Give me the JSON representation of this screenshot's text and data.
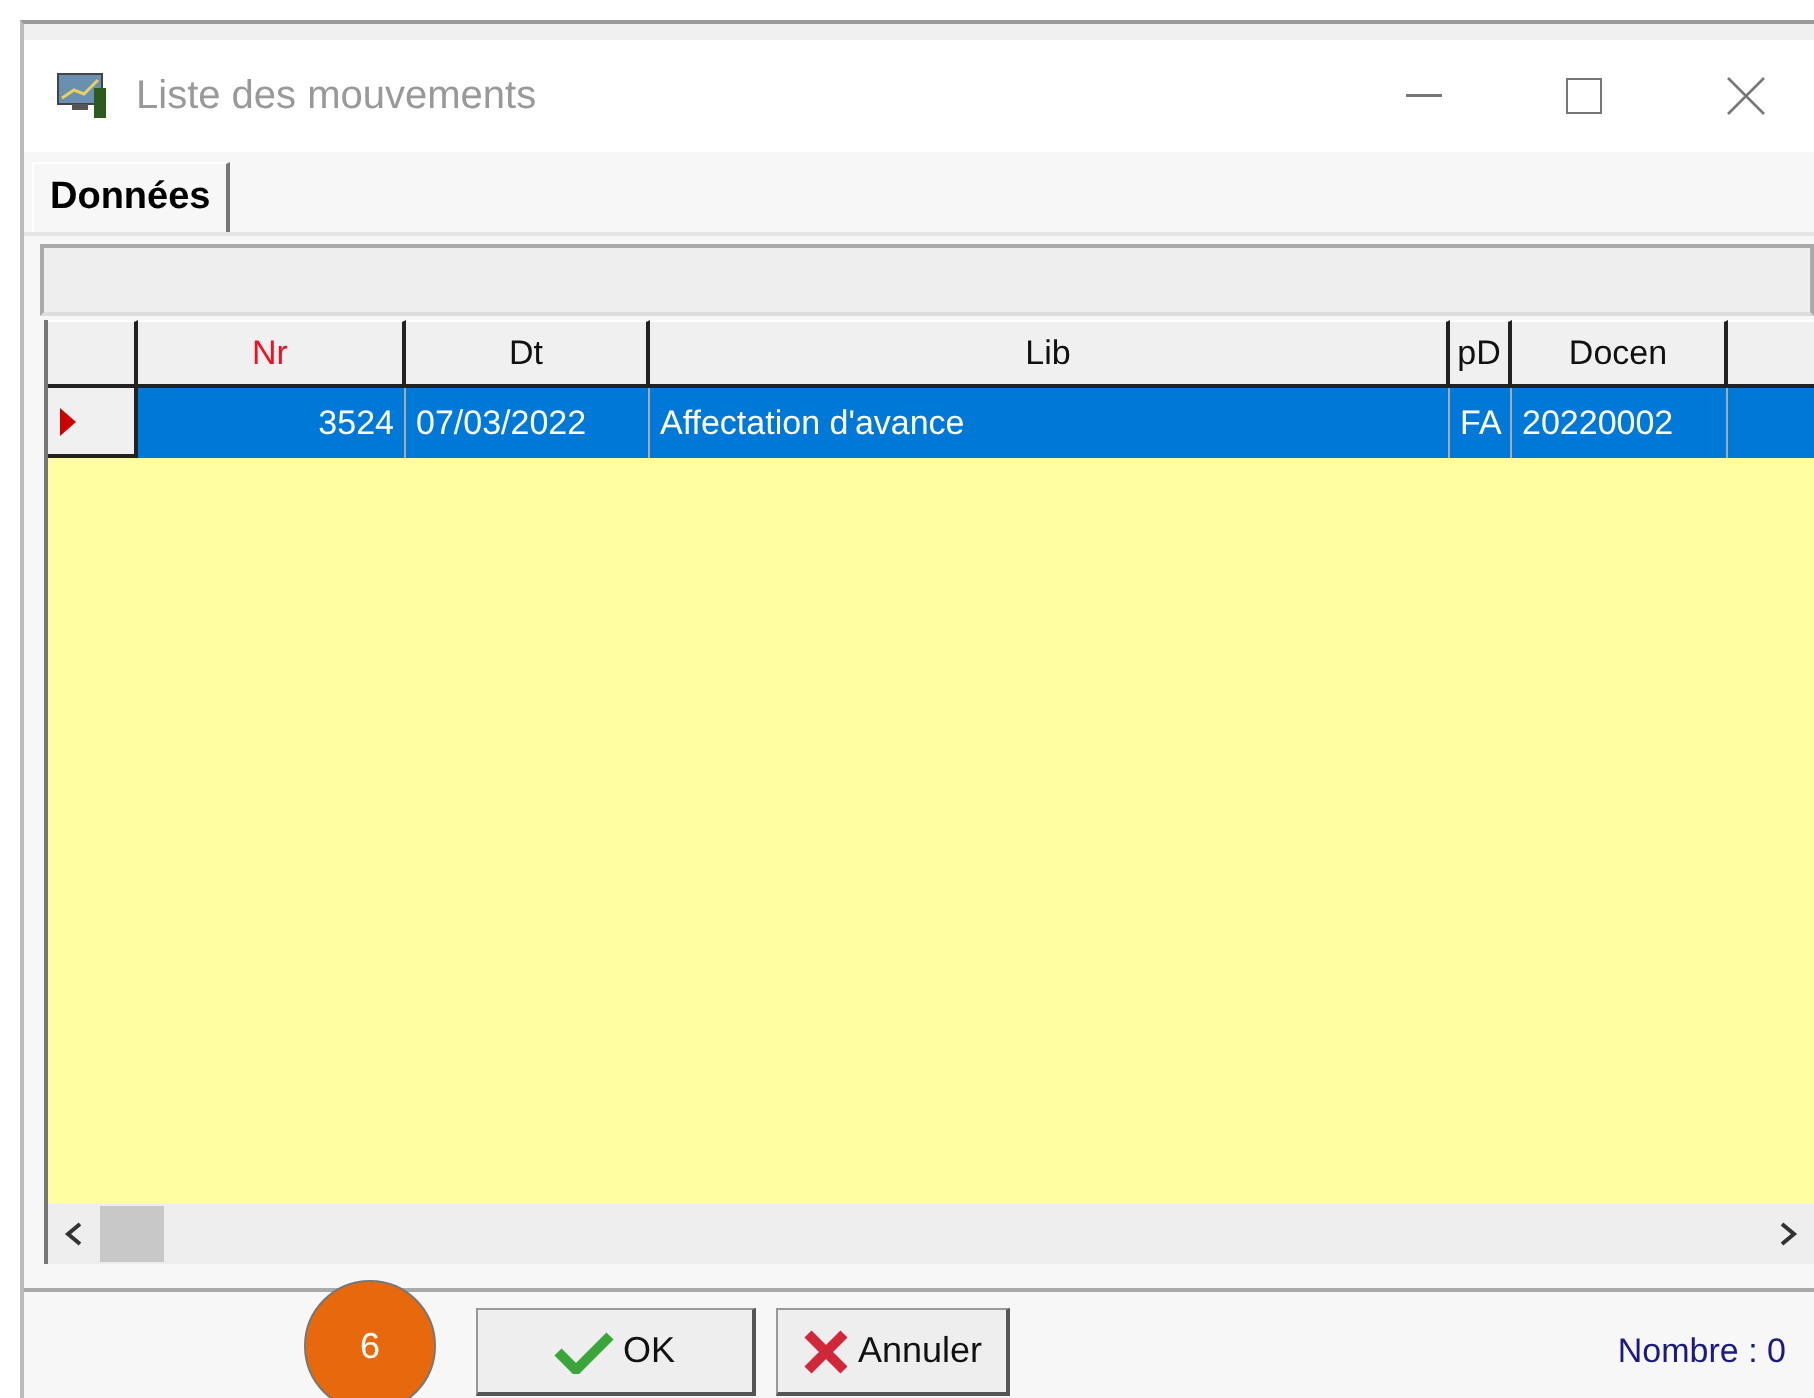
{
  "window": {
    "title": "Liste des mouvements"
  },
  "tabs": [
    {
      "label": "Données",
      "selected": true
    }
  ],
  "table": {
    "columns": [
      {
        "label": "Nr",
        "key_field": true
      },
      {
        "label": "Dt",
        "key_field": false
      },
      {
        "label": "Lib",
        "key_field": false
      },
      {
        "label": "pD",
        "key_field": false
      },
      {
        "label": "Docen",
        "key_field": false
      }
    ],
    "rows": [
      {
        "selected": true,
        "cells": [
          "3524",
          "07/03/2022",
          "Affectation d'avance",
          "FA",
          "20220002"
        ]
      }
    ]
  },
  "callout": "6",
  "buttons": [
    {
      "kind": "ok",
      "label": "OK"
    },
    {
      "kind": "cancel",
      "label": "Annuler"
    }
  ],
  "status": "Nombre : 0"
}
